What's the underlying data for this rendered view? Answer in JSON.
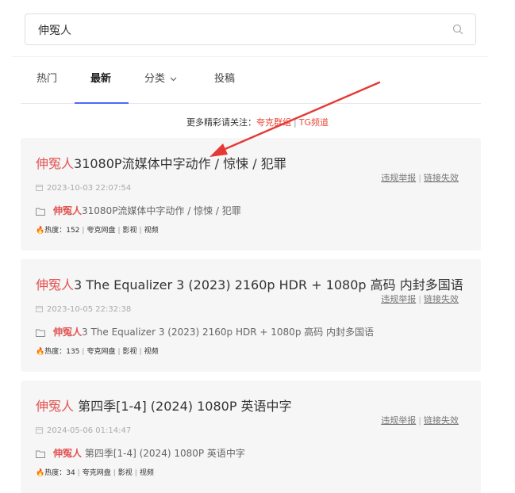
{
  "search": {
    "value": "伸冤人"
  },
  "tabs": [
    {
      "label": "热门"
    },
    {
      "label": "最新"
    },
    {
      "label": "分类"
    },
    {
      "label": "投稿"
    }
  ],
  "notice": {
    "prefix": "更多精彩请关注：",
    "link1": "夸克群组",
    "separator": "|",
    "link2": "TG频道"
  },
  "accent_color": "#4a6cf7",
  "highlight_color": "#e25555",
  "results": [
    {
      "highlight": "伸冤人",
      "title_rest": "31080P流媒体中字动作 / 惊悚 / 犯罪",
      "date": "2023-10-03 22:07:54",
      "path_rest": "31080P流媒体中字动作 / 惊悚 / 犯罪",
      "heat": "热度：152",
      "drive": "夸克网盘",
      "cat1": "影视",
      "cat2": "视频",
      "report": "违规举报",
      "action_sep": "|",
      "invalid": "链接失效"
    },
    {
      "highlight": "伸冤人",
      "title_rest": "3 The Equalizer 3 (2023) 2160p HDR + 1080p 高码 内封多国语",
      "date": "2023-10-05 22:32:38",
      "path_rest": "3 The Equalizer 3 (2023) 2160p HDR + 1080p 高码 内封多国语",
      "heat": "热度：135",
      "drive": "夸克网盘",
      "cat1": "影视",
      "cat2": "视频",
      "report": "违规举报",
      "action_sep": "|",
      "invalid": "链接失效"
    },
    {
      "highlight": "伸冤人",
      "title_rest": " 第四季[1-4] (2024) 1080P 英语中字",
      "date": "2024-05-06 01:14:47",
      "path_rest": " 第四季[1-4] (2024) 1080P 英语中字",
      "heat": "热度：34",
      "drive": "夸克网盘",
      "cat1": "影视",
      "cat2": "视频",
      "report": "违规举报",
      "action_sep": "|",
      "invalid": "链接失效"
    }
  ]
}
